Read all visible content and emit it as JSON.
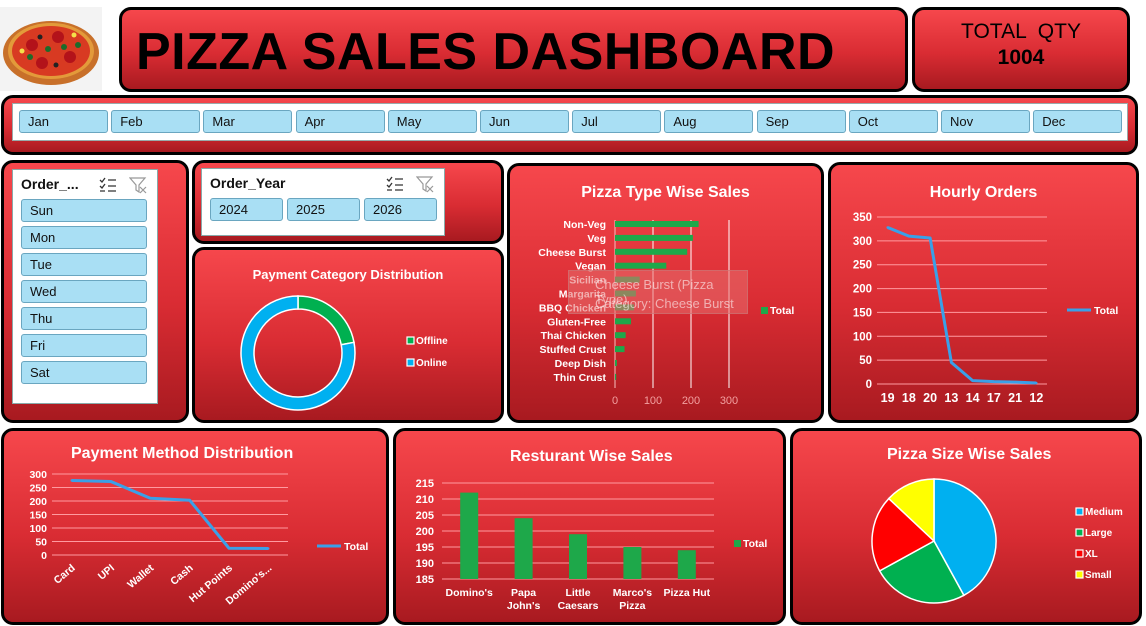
{
  "header": {
    "title": "PIZZA  SALES DASHBOARD",
    "total_qty_label": "TOTAL  QTY",
    "total_qty_value": "1004"
  },
  "months": [
    "Jan",
    "Feb",
    "Mar",
    "Apr",
    "May",
    "Jun",
    "Jul",
    "Aug",
    "Sep",
    "Oct",
    "Nov",
    "Dec"
  ],
  "day_slicer": {
    "title": "Order_...",
    "items": [
      "Sun",
      "Mon",
      "Tue",
      "Wed",
      "Thu",
      "Fri",
      "Sat"
    ]
  },
  "year_slicer": {
    "title": "Order_Year",
    "items": [
      "2024",
      "2025",
      "2026"
    ]
  },
  "tooltip": {
    "line1": "Cheese Burst (Pizza Type)",
    "line2": "Category: Cheese Burst"
  },
  "colors": {
    "panel_red": "#e8383e",
    "slicer_blue": "#a9dff4",
    "bar_green": "#1ea84a",
    "line_blue": "#3aa0e8",
    "pie_blue": "#00b0f0",
    "pie_green": "#00b050",
    "pie_red": "#ff0000",
    "pie_yellow": "#ffff00"
  },
  "chart_data": [
    {
      "id": "payment_category",
      "type": "pie",
      "title": "Payment Category Distribution",
      "categories": [
        "Offline",
        "Online"
      ],
      "values": [
        22,
        78
      ],
      "colors": [
        "#00b050",
        "#00b0f0"
      ]
    },
    {
      "id": "pizza_type",
      "type": "bar",
      "title": "Pizza Type Wise Sales",
      "categories": [
        "Non-Veg",
        "Veg",
        "Cheese Burst",
        "Vegan",
        "Sicilian",
        "Margarita",
        "BBQ Chicken",
        "Gluten-Free",
        "Thai Chicken",
        "Stuffed Crust",
        "Deep Dish",
        "Thin Crust"
      ],
      "series": [
        {
          "name": "Total",
          "values": [
            220,
            205,
            190,
            135,
            65,
            55,
            50,
            42,
            28,
            25,
            5,
            3
          ]
        }
      ],
      "xticks": [
        "0",
        "100",
        "200",
        "300"
      ],
      "xlim": [
        0,
        300
      ]
    },
    {
      "id": "hourly_orders",
      "type": "line",
      "title": "Hourly Orders",
      "categories": [
        "19",
        "18",
        "20",
        "13",
        "14",
        "17",
        "21",
        "12"
      ],
      "series": [
        {
          "name": "Total",
          "values": [
            328,
            310,
            306,
            45,
            7,
            5,
            4,
            2
          ]
        }
      ],
      "yticks": [
        "0",
        "50",
        "100",
        "150",
        "200",
        "250",
        "300",
        "350"
      ],
      "ylim": [
        0,
        350
      ]
    },
    {
      "id": "payment_method",
      "type": "line",
      "title": "Payment Method Distribution",
      "categories": [
        "Card",
        "UPI",
        "Wallet",
        "Cash",
        "Hut Points",
        "Domino's..."
      ],
      "series": [
        {
          "name": "Total",
          "values": [
            276,
            272,
            210,
            203,
            25,
            24
          ]
        }
      ],
      "yticks": [
        "0",
        "50",
        "100",
        "150",
        "200",
        "250",
        "300"
      ],
      "ylim": [
        0,
        300
      ]
    },
    {
      "id": "restaurant",
      "type": "bar",
      "title": "Resturant Wise Sales",
      "categories": [
        "Domino's",
        "Papa John's",
        "Little Caesars",
        "Marco's Pizza",
        "Pizza Hut"
      ],
      "series": [
        {
          "name": "Total",
          "values": [
            212,
            204,
            199,
            195,
            194
          ]
        }
      ],
      "yticks": [
        "185",
        "190",
        "195",
        "200",
        "205",
        "210",
        "215"
      ],
      "ylim": [
        185,
        215
      ]
    },
    {
      "id": "pizza_size",
      "type": "pie",
      "title": "Pizza Size Wise Sales",
      "categories": [
        "Medium",
        "Large",
        "XL",
        "Small"
      ],
      "values": [
        42,
        25,
        20,
        13
      ],
      "colors": [
        "#00b0f0",
        "#00b050",
        "#ff0000",
        "#ffff00"
      ]
    }
  ]
}
